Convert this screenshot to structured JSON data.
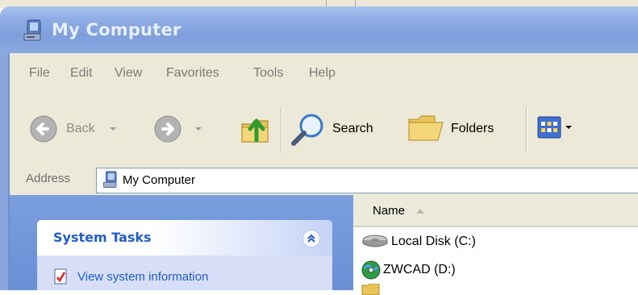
{
  "window": {
    "title": "My Computer"
  },
  "menu": {
    "items": [
      "File",
      "Edit",
      "View",
      "Favorites",
      "Tools",
      "Help"
    ]
  },
  "toolbar": {
    "back_label": "Back",
    "search_label": "Search",
    "folders_label": "Folders"
  },
  "address": {
    "label": "Address",
    "value": "My Computer"
  },
  "task_pane": {
    "section_title": "System Tasks",
    "links": [
      "View system information"
    ]
  },
  "file_list": {
    "column_name": "Name",
    "items": [
      {
        "label": "Local Disk (C:)",
        "icon": "hard-disk-icon"
      },
      {
        "label": "ZWCAD (D:)",
        "icon": "cd-drive-icon"
      },
      {
        "label": "",
        "icon": "folder-icon"
      }
    ]
  },
  "colors": {
    "title_bar": "#8aa9e2",
    "task_header_text": "#215dc6",
    "task_pane_bg": "#7b9ede",
    "chrome": "#ece9d8"
  }
}
